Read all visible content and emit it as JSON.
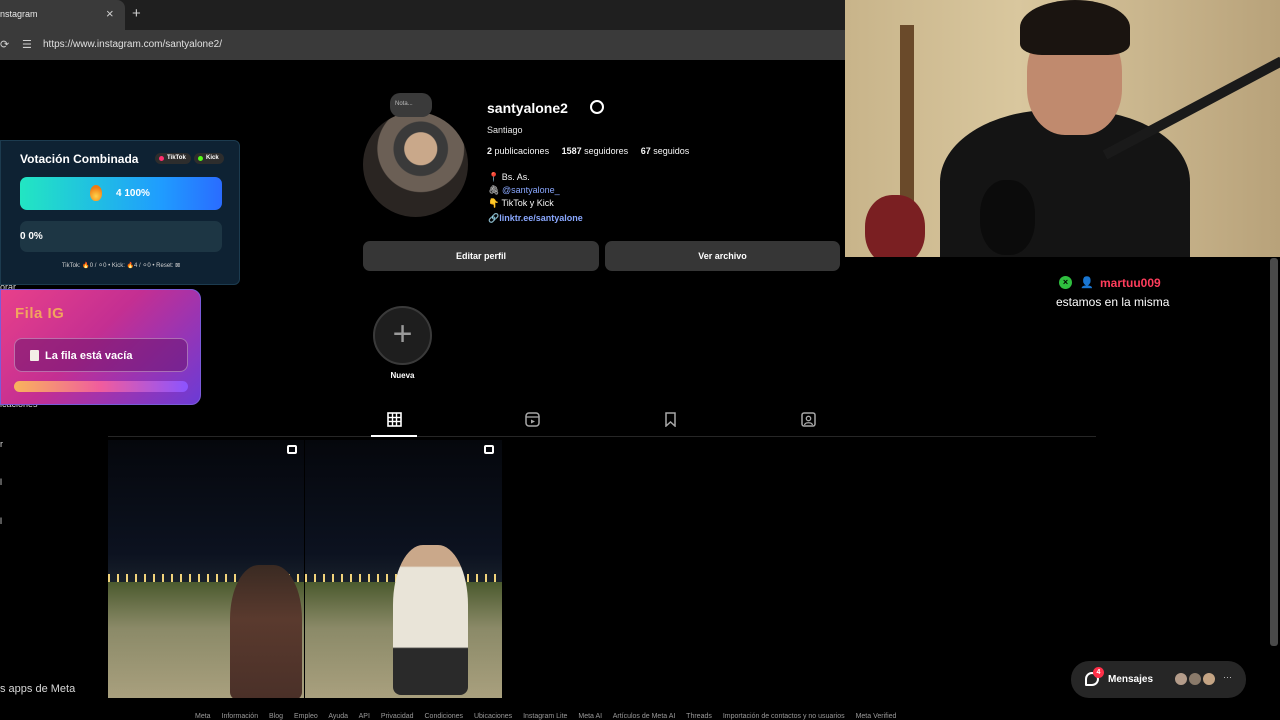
{
  "browser": {
    "tab_title": "nstagram",
    "tab_close": "×",
    "new_tab": "+",
    "url": "https://www.instagram.com/santyalone2/"
  },
  "vote_widget": {
    "title": "Votación Combinada",
    "pill_tiktok": "TikTok",
    "pill_kick": "Kick",
    "option1": "4   100%",
    "option2": "0   0%",
    "footer": "TikTok: 🔥0 / ⚪0    •    Kick: 🔥4 / ⚪0    •    Reset: ⊠",
    "colors": {
      "bar_start": "#22e6c2",
      "bar_end": "#2a6cff",
      "tiktok_dot": "#ff2f6e",
      "kick_dot": "#53fc18"
    }
  },
  "fila_widget": {
    "title": "Fila IG",
    "empty_text": "La fila está vacía"
  },
  "sidebar_fragments": {
    "f1": "orar",
    "f2": "icaciones",
    "f3": "r",
    "f4": "l",
    "f5": "l",
    "f6": "s apps de Meta",
    "f7": "ar"
  },
  "profile": {
    "note": "Nota...",
    "username": "santyalone2",
    "full_name": "Santiago",
    "posts_count": "2",
    "posts_label": "publicaciones",
    "followers_count": "1587",
    "followers_label": "seguidores",
    "following_count": "67",
    "following_label": "seguidos",
    "bio_line1": "📍 Bs. As.",
    "bio_line2": "@santyalone_",
    "bio_line3": "👇 TikTok y Kick",
    "bio_link": "linktr.ee/santyalone",
    "edit_button": "Editar perfil",
    "archive_button": "Ver archivo",
    "new_highlight_label": "Nueva",
    "new_highlight_plus": "+"
  },
  "chat": {
    "badge": "×",
    "user_icon": "👤",
    "username": "martuu009",
    "message": "estamos en la misma"
  },
  "messages": {
    "label": "Mensajes",
    "count": "4",
    "more": "···"
  },
  "footer_links": [
    "Meta",
    "Información",
    "Blog",
    "Empleo",
    "Ayuda",
    "API",
    "Privacidad",
    "Condiciones",
    "Ubicaciones",
    "Instagram Lite",
    "Meta AI",
    "Artículos de Meta AI",
    "Threads",
    "Importación de contactos y no usuarios",
    "Meta Verified"
  ]
}
